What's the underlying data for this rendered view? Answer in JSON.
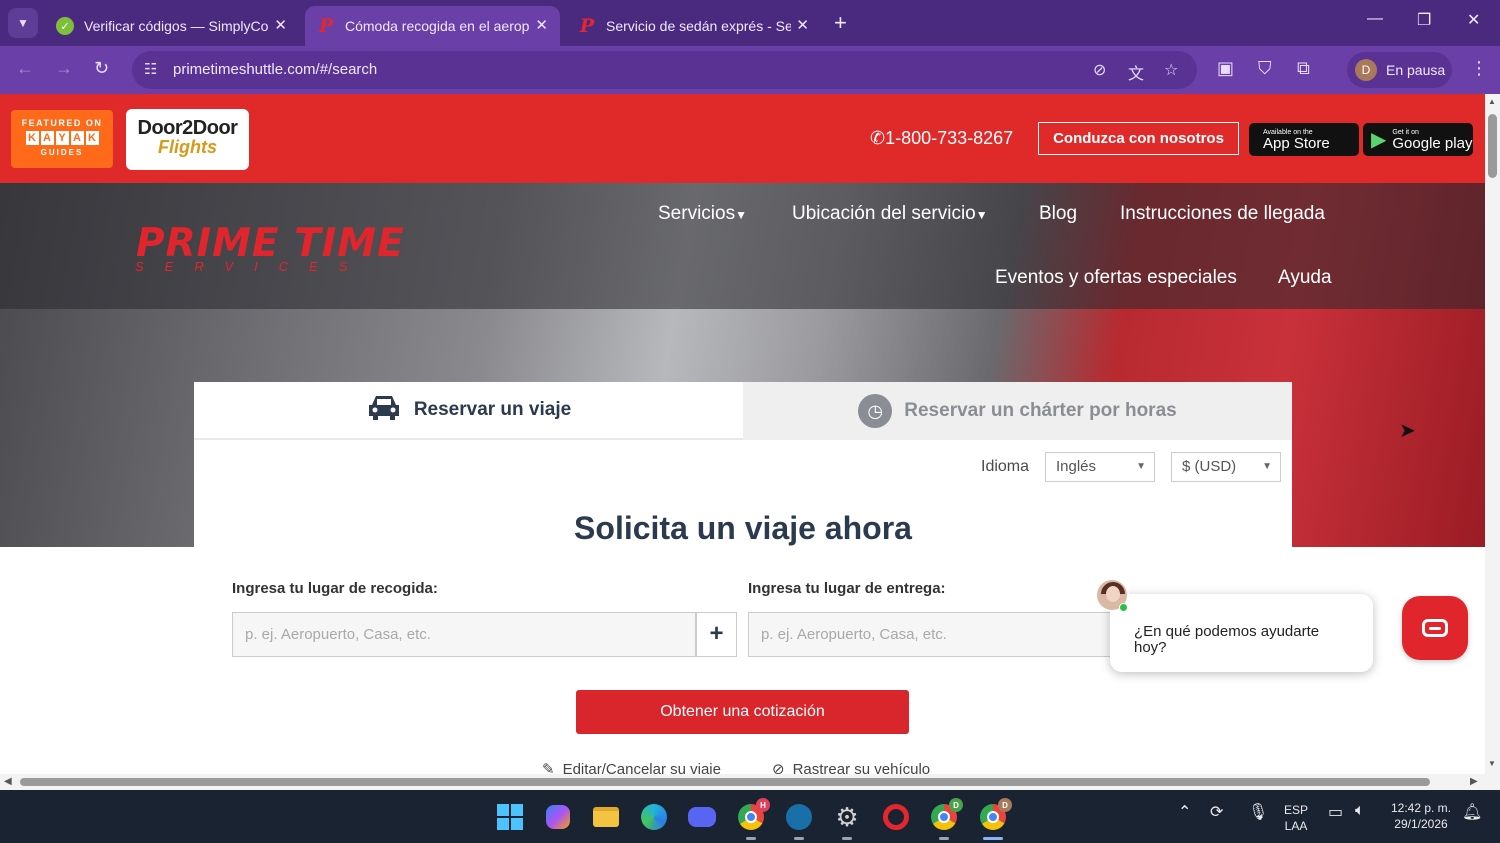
{
  "browser": {
    "tabs": [
      {
        "title": "Verificar códigos — SimplyCodes",
        "favicon": "check-circle-icon"
      },
      {
        "title": "Cómoda recogida en el aeropuerto",
        "favicon": "p-logo-icon"
      },
      {
        "title": "Servicio de sedán exprés - Servicio",
        "favicon": "p-logo-icon"
      }
    ],
    "url": "primetimeshuttle.com/#/search",
    "profile_initial": "D",
    "profile_status": "En pausa"
  },
  "header": {
    "kayak_line1": "FEATURED ON",
    "kayak_letters": [
      "K",
      "A",
      "Y",
      "A",
      "K"
    ],
    "kayak_line3": "GUIDES",
    "d2d_line1": "Door2Door",
    "d2d_line2": "Flights",
    "phone": "1-800-733-8267",
    "drive_button": "Conduzca con nosotros",
    "appstore_small": "Available on the",
    "appstore_big": "App Store",
    "googleplay_small": "Get it on",
    "googleplay_big": "Google play"
  },
  "brand": {
    "name": "PRIME TIME",
    "sub": "SERVICES"
  },
  "nav": {
    "services": "Servicios",
    "location": "Ubicación del servicio",
    "blog": "Blog",
    "arrival": "Instrucciones de llegada",
    "events": "Eventos y ofertas especiales",
    "help": "Ayuda"
  },
  "booking": {
    "tab_trip": "Reservar un viaje",
    "tab_charter": "Reservar un chárter por horas",
    "language_label": "Idioma",
    "language_value": "Inglés",
    "currency_value": "$ (USD)",
    "heading": "Solicita un viaje ahora",
    "pickup_label": "Ingresa tu lugar de recogida:",
    "pickup_placeholder": "p. ej. Aeropuerto, Casa, etc.",
    "dropoff_label": "Ingresa tu lugar de entrega:",
    "dropoff_placeholder": "p. ej. Aeropuerto, Casa, etc.",
    "quote_button": "Obtener una cotización",
    "edit_link": "Editar/Cancelar su viaje",
    "track_link": "Rastrear su vehículo"
  },
  "chat": {
    "message": "¿En qué podemos ayudarte hoy?"
  },
  "taskbar": {
    "language": "ESP",
    "layout": "LAA",
    "time": "12:42 p. m.",
    "date": "29/1/2026",
    "chrome_badges": [
      "H",
      "D",
      "D"
    ]
  },
  "colors": {
    "brand_red": "#e02a2a",
    "chrome_purple": "#6a3fa8",
    "heading_navy": "#2b3a4e"
  }
}
